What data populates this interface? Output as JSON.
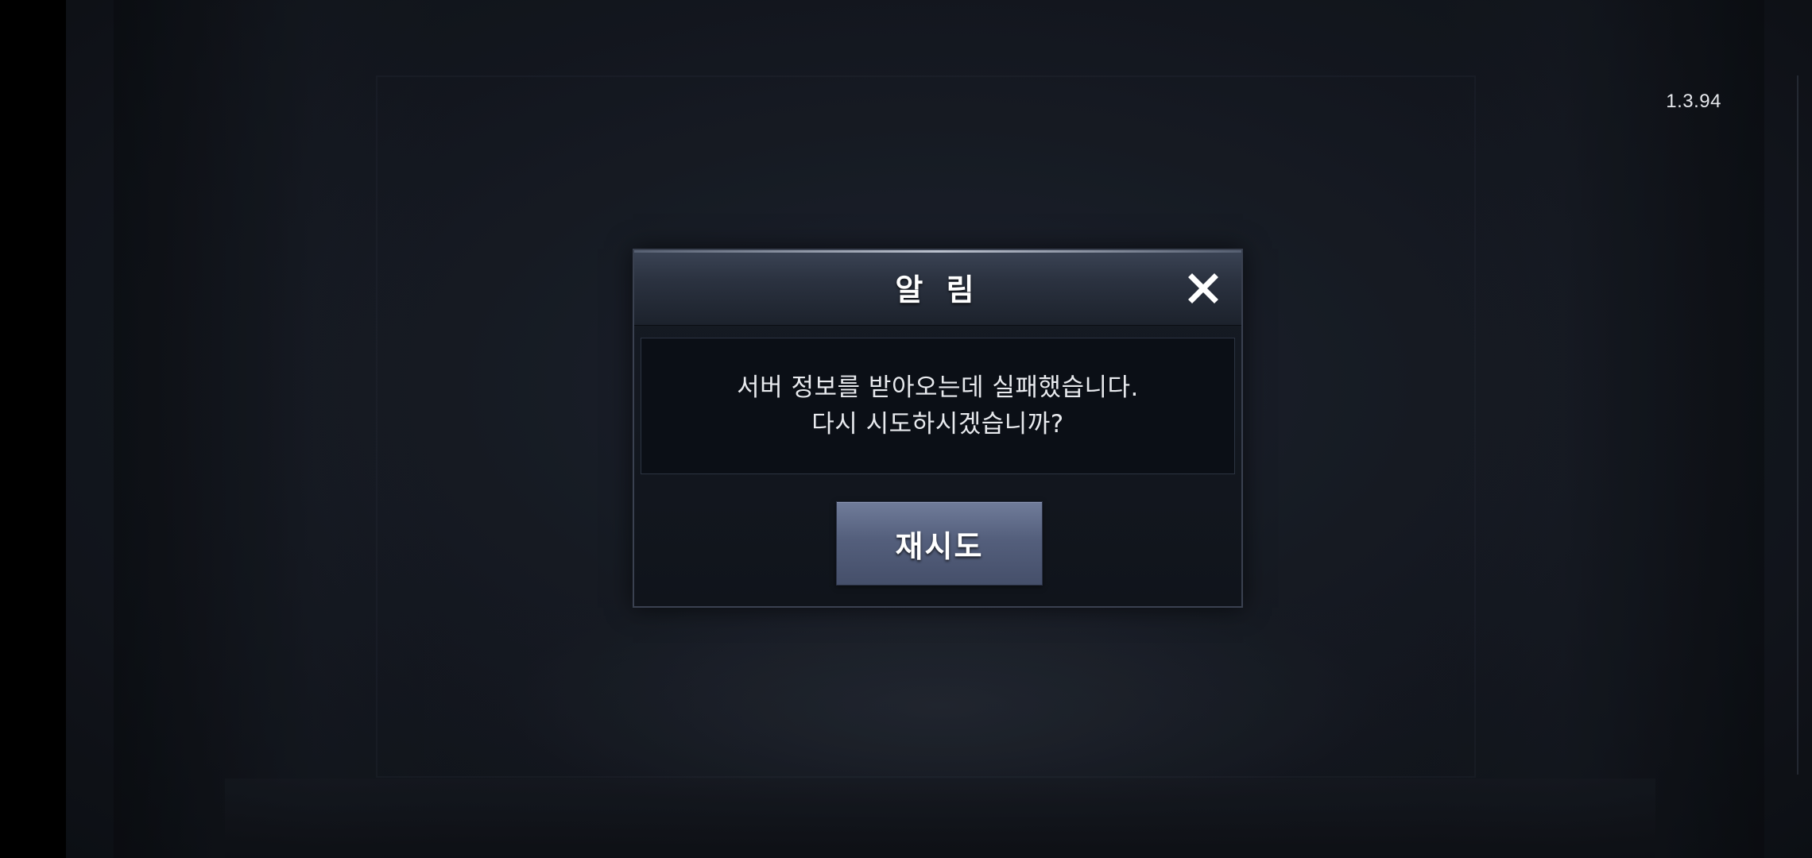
{
  "app": {
    "version": "1.3.94"
  },
  "dialog": {
    "title": "알 림",
    "message_lines": [
      "서버 정보를 받아오는데 실패했습니다.",
      "다시 시도하시겠습니까?"
    ],
    "retry_label": "재시도",
    "close_icon": "close-icon"
  },
  "colors": {
    "background": "#141820",
    "dialog_header": "#2b3240",
    "message_box": "#0b0f16",
    "retry_button": "#545f7c",
    "text": "#ffffff"
  }
}
